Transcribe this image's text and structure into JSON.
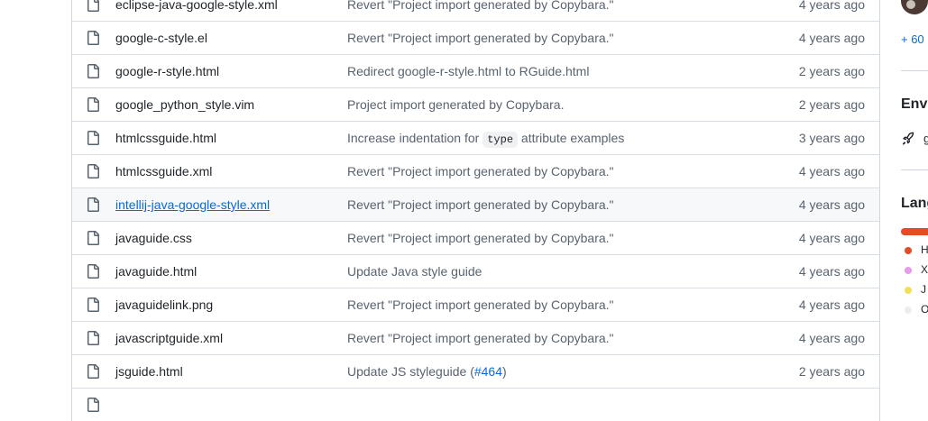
{
  "files": [
    {
      "name": "eclipse-java-google-style.xml",
      "message": "Revert \"Project import generated by Copybara.\"",
      "age": "4 years ago"
    },
    {
      "name": "google-c-style.el",
      "message": "Revert \"Project import generated by Copybara.\"",
      "age": "4 years ago"
    },
    {
      "name": "google-r-style.html",
      "message": "Redirect google-r-style.html to RGuide.html",
      "age": "2 years ago"
    },
    {
      "name": "google_python_style.vim",
      "message": "Project import generated by Copybara.",
      "age": "2 years ago"
    },
    {
      "name": "htmlcssguide.html",
      "message_before": "Increase indentation for ",
      "message_code": "type",
      "message_after": " attribute examples",
      "age": "3 years ago"
    },
    {
      "name": "htmlcssguide.xml",
      "message": "Revert \"Project import generated by Copybara.\"",
      "age": "4 years ago"
    },
    {
      "name": "intellij-java-google-style.xml",
      "message": "Revert \"Project import generated by Copybara.\"",
      "age": "4 years ago"
    },
    {
      "name": "javaguide.css",
      "message": "Revert \"Project import generated by Copybara.\"",
      "age": "4 years ago"
    },
    {
      "name": "javaguide.html",
      "message": "Update Java style guide",
      "age": "4 years ago"
    },
    {
      "name": "javaguidelink.png",
      "message": "Revert \"Project import generated by Copybara.\"",
      "age": "4 years ago"
    },
    {
      "name": "javascriptguide.xml",
      "message": "Revert \"Project import generated by Copybara.\"",
      "age": "4 years ago"
    },
    {
      "name": "jsguide.html",
      "message_before": "Update JS styleguide (",
      "message_link": "#464",
      "message_after": ")",
      "age": "2 years ago"
    },
    {
      "name": "",
      "message": "",
      "age": ""
    }
  ],
  "sidebar": {
    "more_contributors": "+ 60",
    "environments_heading": "Envi",
    "environment_item": "g",
    "languages_heading": "Lang",
    "languages": [
      {
        "name": "H",
        "color": "#e34c26"
      },
      {
        "name": "X",
        "color": "#e69ae8"
      },
      {
        "name": "J",
        "color": "#f1e05a"
      },
      {
        "name": "O",
        "color": "#ededed"
      }
    ]
  },
  "colors": {
    "link": "#0969da",
    "muted": "#59636e",
    "border": "#d0d7de"
  }
}
